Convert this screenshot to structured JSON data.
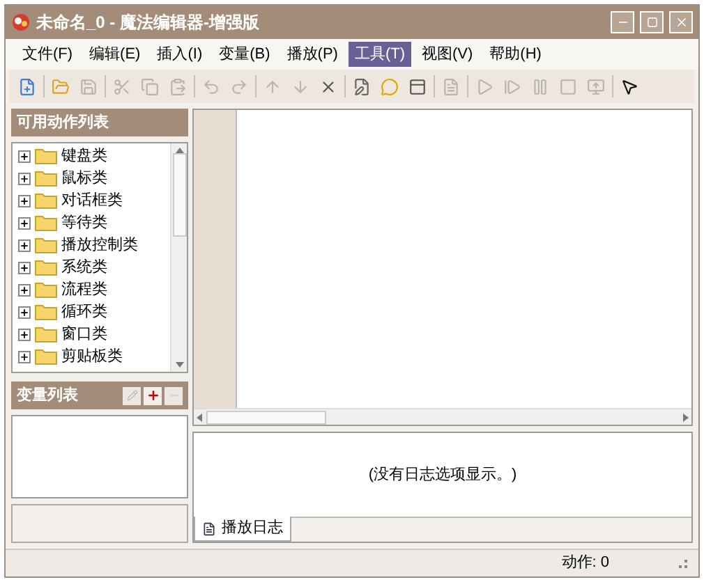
{
  "window": {
    "title": "未命名_0 - 魔法编辑器-增强版"
  },
  "menu": [
    {
      "label": "文件(F)",
      "selected": false
    },
    {
      "label": "编辑(E)",
      "selected": false
    },
    {
      "label": "插入(I)",
      "selected": false
    },
    {
      "label": "变量(B)",
      "selected": false
    },
    {
      "label": "播放(P)",
      "selected": false
    },
    {
      "label": "工具(T)",
      "selected": true
    },
    {
      "label": "视图(V)",
      "selected": false
    },
    {
      "label": "帮助(H)",
      "selected": false
    }
  ],
  "toolbar": [
    {
      "kind": "button",
      "disabled": false
    },
    {
      "kind": "separator"
    },
    {
      "kind": "button",
      "disabled": false
    },
    {
      "kind": "button",
      "disabled": true
    },
    {
      "kind": "separator"
    },
    {
      "kind": "button",
      "disabled": true
    },
    {
      "kind": "button",
      "disabled": true
    },
    {
      "kind": "button",
      "disabled": true
    },
    {
      "kind": "separator"
    },
    {
      "kind": "button",
      "disabled": true
    },
    {
      "kind": "button",
      "disabled": true
    },
    {
      "kind": "separator"
    },
    {
      "kind": "button",
      "disabled": true
    },
    {
      "kind": "button",
      "disabled": true
    },
    {
      "kind": "button",
      "disabled": false
    },
    {
      "kind": "separator"
    },
    {
      "kind": "button",
      "disabled": false
    },
    {
      "kind": "button",
      "disabled": false
    },
    {
      "kind": "button",
      "disabled": false
    },
    {
      "kind": "separator"
    },
    {
      "kind": "button",
      "disabled": true
    },
    {
      "kind": "separator"
    },
    {
      "kind": "button",
      "disabled": true
    },
    {
      "kind": "button",
      "disabled": true
    },
    {
      "kind": "button",
      "disabled": true
    },
    {
      "kind": "button",
      "disabled": true
    },
    {
      "kind": "button",
      "disabled": true
    },
    {
      "kind": "separator"
    },
    {
      "kind": "button",
      "disabled": false
    }
  ],
  "actions_panel": {
    "title": "可用动作列表",
    "items": [
      {
        "label": "键盘类",
        "expanded": false
      },
      {
        "label": "鼠标类",
        "expanded": false
      },
      {
        "label": "对话框类",
        "expanded": false
      },
      {
        "label": "等待类",
        "expanded": false
      },
      {
        "label": "播放控制类",
        "expanded": false
      },
      {
        "label": "系统类",
        "expanded": false
      },
      {
        "label": "流程类",
        "expanded": false
      },
      {
        "label": "循环类",
        "expanded": false
      },
      {
        "label": "窗口类",
        "expanded": false
      },
      {
        "label": "剪贴板类",
        "expanded": false
      }
    ]
  },
  "variables_panel": {
    "title": "变量列表"
  },
  "log_panel": {
    "message": "(没有日志选项显示。)",
    "tabs": [
      {
        "label": "播放日志",
        "selected": true
      }
    ]
  },
  "status_bar": {
    "actions": "动作: 0"
  }
}
